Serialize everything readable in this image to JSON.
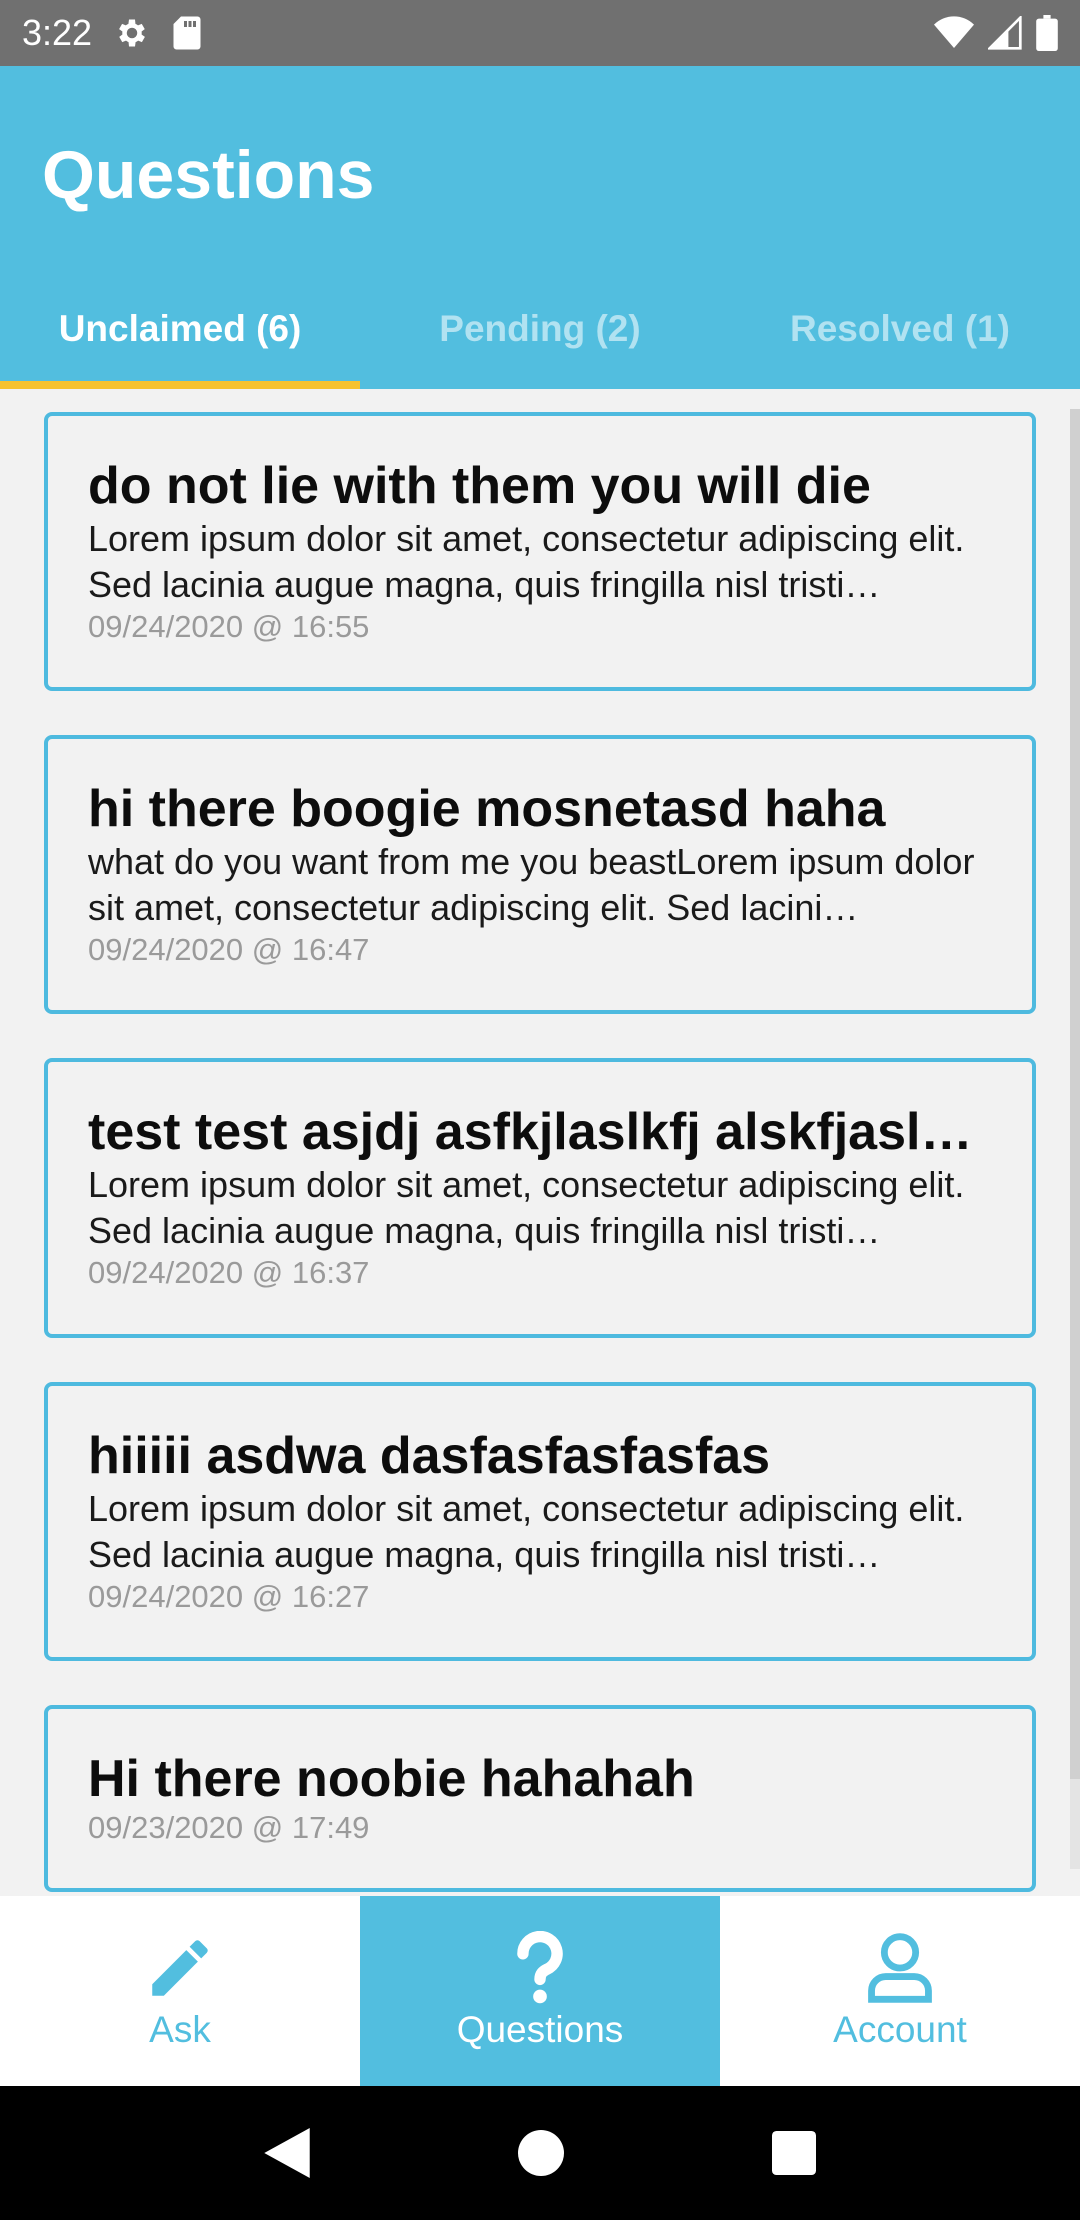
{
  "status_bar": {
    "time": "3:22",
    "icons_left": [
      "settings-icon",
      "sd-card-icon"
    ],
    "icons_right": [
      "wifi-icon",
      "signal-icon",
      "battery-icon"
    ]
  },
  "header": {
    "title": "Questions"
  },
  "tabs": [
    {
      "label": "Unclaimed (6)",
      "active": true
    },
    {
      "label": "Pending (2)",
      "active": false
    },
    {
      "label": "Resolved (1)",
      "active": false
    }
  ],
  "questions": [
    {
      "title": "do not lie with them you will die",
      "body": "Lorem ipsum dolor sit amet, consectetur adipiscing elit. Sed lacinia augue magna, quis fringilla nisl tristi…",
      "date": "09/24/2020 @ 16:55"
    },
    {
      "title": "hi there boogie mosnetasd haha",
      "body": "what do you want from me you beastLorem ipsum dolor sit amet, consectetur adipiscing elit. Sed lacini…",
      "date": "09/24/2020 @ 16:47"
    },
    {
      "title": "test test asjdj asfkjlaslkfj alskfjasl…",
      "body": "Lorem ipsum dolor sit amet, consectetur adipiscing elit. Sed lacinia augue magna, quis fringilla nisl tristi…",
      "date": "09/24/2020 @ 16:37"
    },
    {
      "title": "hiiiii asdwa dasfasfasfasfas",
      "body": "Lorem ipsum dolor sit amet, consectetur adipiscing elit. Sed lacinia augue magna, quis fringilla nisl tristi…",
      "date": "09/24/2020 @ 16:27"
    },
    {
      "title": "Hi there noobie hahahah",
      "body": "",
      "date": "09/23/2020 @ 17:49"
    }
  ],
  "bottom_nav": [
    {
      "label": "Ask",
      "icon": "pencil-icon",
      "active": false
    },
    {
      "label": "Questions",
      "icon": "question-icon",
      "active": true
    },
    {
      "label": "Account",
      "icon": "account-icon",
      "active": false
    }
  ],
  "colors": {
    "primary": "#52bedf",
    "tab_indicator": "#f6c22e",
    "card_border": "#4ebadf"
  }
}
